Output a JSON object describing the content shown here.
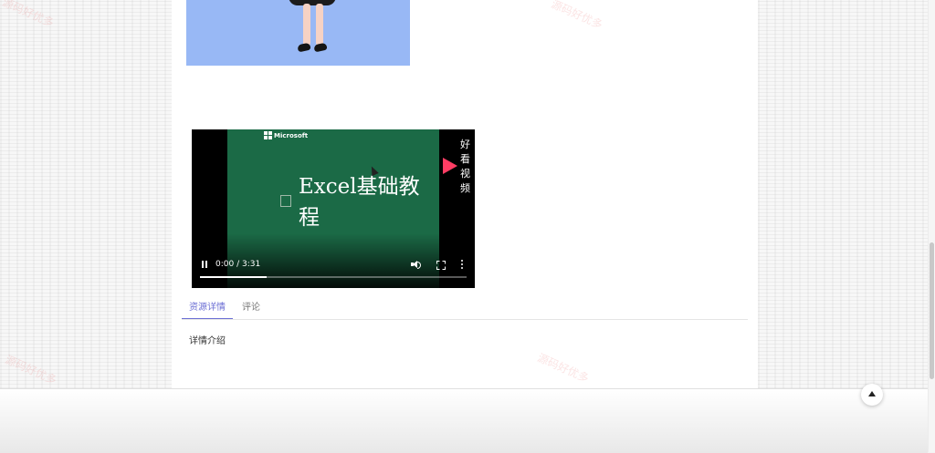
{
  "video": {
    "microsoft_label": "Microsoft",
    "brand_label": "好看视频",
    "title": "Excel基础教程",
    "time": "0:00 / 3:31",
    "progress": 0.25
  },
  "tabs": [
    {
      "label": "资源详情"
    },
    {
      "label": "评论"
    }
  ],
  "details": {
    "label": "详情介绍"
  },
  "watermarks": [
    "源码好优多",
    "源码好优多",
    "源码好优多",
    "源码好优多"
  ],
  "colors": {
    "accent": "#6c6fd4",
    "video_background": "#1b6a46",
    "illustration_background": "#98b8f5"
  },
  "icons": [
    "microsoft-logo",
    "video-brand-play-icon",
    "pause-icon",
    "volume-icon",
    "fullscreen-icon",
    "more-icon",
    "back-to-top-icon"
  ]
}
